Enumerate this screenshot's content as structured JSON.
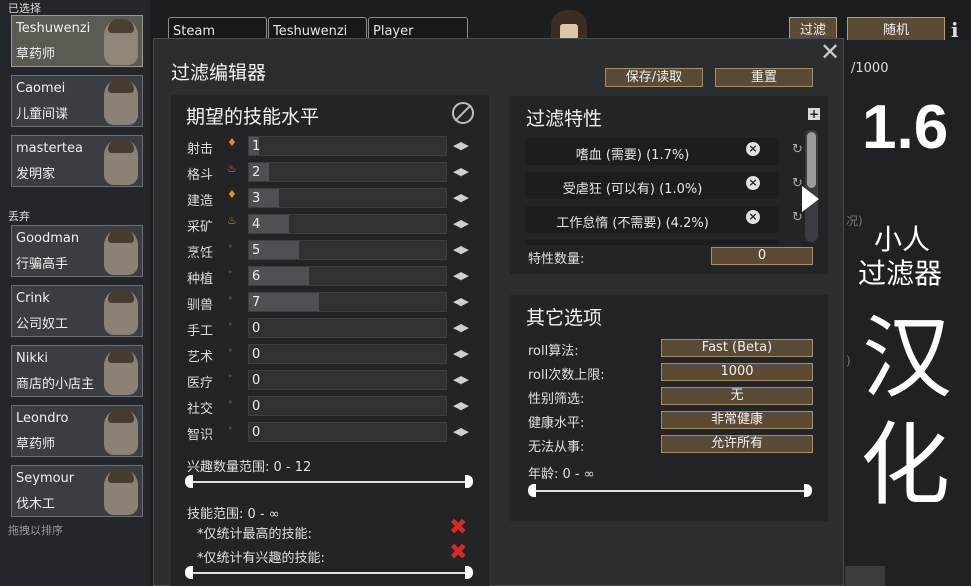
{
  "left": {
    "selected_label": "已选择",
    "discarded_label": "丢弃",
    "drag_hint": "拖拽以排序",
    "selected": [
      {
        "name": "Teshuwenzi",
        "title": "草药师"
      },
      {
        "name": "Caomei",
        "title": "儿童间谍"
      },
      {
        "name": "mastertea",
        "title": "发明家"
      }
    ],
    "discarded": [
      {
        "name": "Goodman",
        "title": "行骗高手"
      },
      {
        "name": "Crink",
        "title": "公司奴工"
      },
      {
        "name": "Nikki",
        "title": "商店的小店主"
      },
      {
        "name": "Leondro",
        "title": "草药师"
      },
      {
        "name": "Seymour",
        "title": "伐木工"
      }
    ]
  },
  "topbar": {
    "tabs": [
      "Steam",
      "Teshuwenzi",
      "Player"
    ],
    "filter_button": "过滤",
    "random_button": "随机",
    "info_icon": "i"
  },
  "right_panel": {
    "progress": "/1000",
    "version": "1.6",
    "title_line1": "小人",
    "title_line2": "过滤器",
    "title_line3": "汉",
    "title_line4": "化",
    "frag1": "况)",
    "frag2": ")"
  },
  "dialog": {
    "title": "过滤编辑器",
    "close_icon": "close-icon",
    "save_load_button": "保存/读取",
    "reset_button": "重置",
    "skills_title": "期望的技能水平",
    "skills": [
      {
        "label": "射击",
        "value": "1",
        "passion": 1
      },
      {
        "label": "格斗",
        "value": "2",
        "passion": 2
      },
      {
        "label": "建造",
        "value": "3",
        "passion": 1
      },
      {
        "label": "采矿",
        "value": "4",
        "passion": 2
      },
      {
        "label": "烹饪",
        "value": "5",
        "passion": 0
      },
      {
        "label": "种植",
        "value": "6",
        "passion": 0
      },
      {
        "label": "驯兽",
        "value": "7",
        "passion": 0
      },
      {
        "label": "手工",
        "value": "0",
        "passion": 0
      },
      {
        "label": "艺术",
        "value": "0",
        "passion": 0
      },
      {
        "label": "医疗",
        "value": "0",
        "passion": 0
      },
      {
        "label": "社交",
        "value": "0",
        "passion": 0
      },
      {
        "label": "智识",
        "value": "0",
        "passion": 0
      }
    ],
    "passion_range": "兴趣数量范围: 0 - 12",
    "skill_range": "技能范围: 0 - ∞",
    "count_highest": "*仅统计最高的技能:",
    "count_passion": "*仅统计有兴趣的技能:",
    "traits_title": "过滤特性",
    "traits": [
      "嗜血 (需要) (1.7%)",
      "受虐狂 (可以有) (1.0%)",
      "工作怠惰 (不需要) (4.2%)"
    ],
    "trait_count_label": "特性数量:",
    "trait_count_value": "0",
    "other_title": "其它选项",
    "options": [
      {
        "label": "roll算法:",
        "value": "Fast (Beta)"
      },
      {
        "label": "roll次数上限:",
        "value": "1000"
      },
      {
        "label": "性别筛选:",
        "value": "无"
      },
      {
        "label": "健康水平:",
        "value": "非常健康"
      },
      {
        "label": "无法从事:",
        "value": "允许所有"
      }
    ],
    "age_range": "年龄: 0 - ∞"
  },
  "colors": {
    "accent_button": "#5b4a36",
    "passion": "#f28a1a",
    "red_x": "#d8282a"
  }
}
